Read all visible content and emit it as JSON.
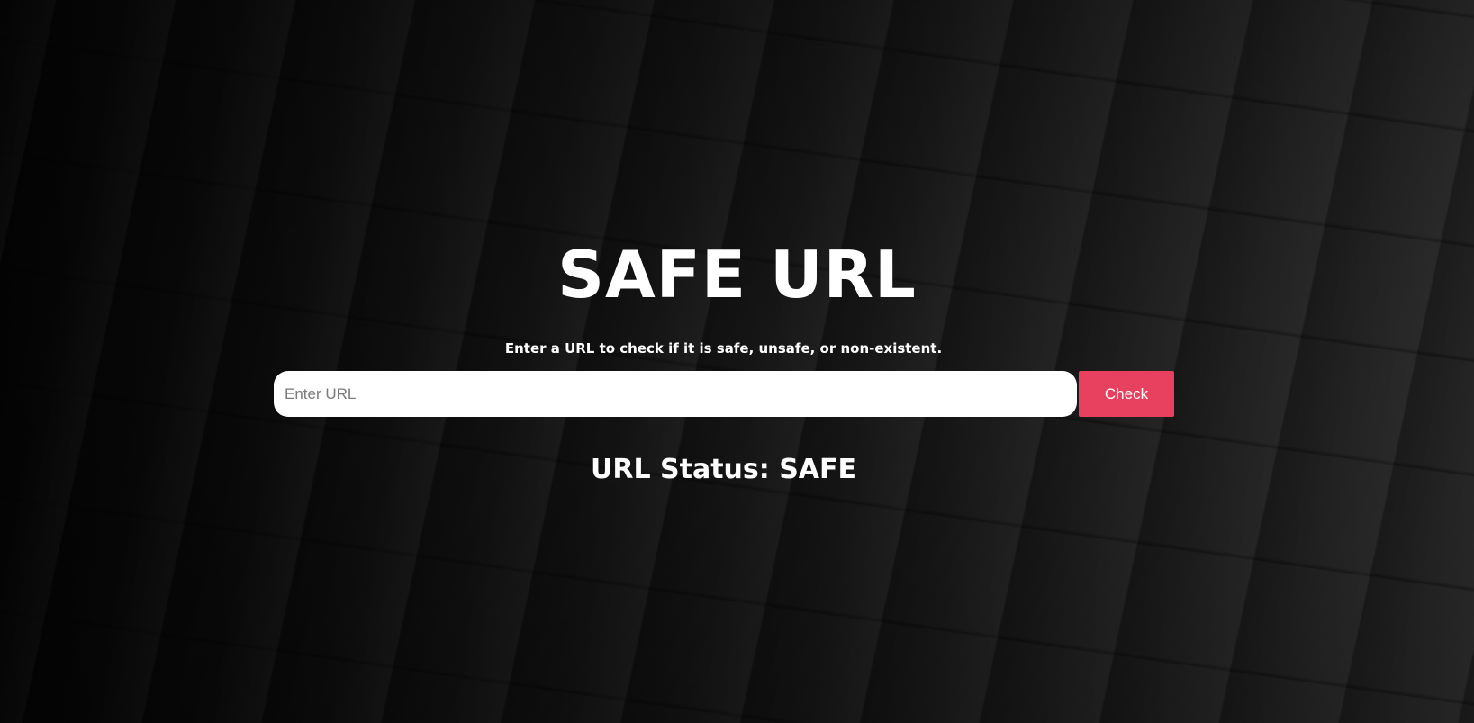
{
  "app": {
    "title": "SAFE URL",
    "subtitle": "Enter a URL to check if it is safe, unsafe, or non-existent."
  },
  "form": {
    "input_value": "",
    "input_placeholder": "Enter URL",
    "check_label": "Check"
  },
  "result": {
    "status_text": "URL Status: SAFE"
  },
  "colors": {
    "accent": "#e8405f",
    "text": "#ffffff",
    "input_bg": "#ffffff"
  }
}
